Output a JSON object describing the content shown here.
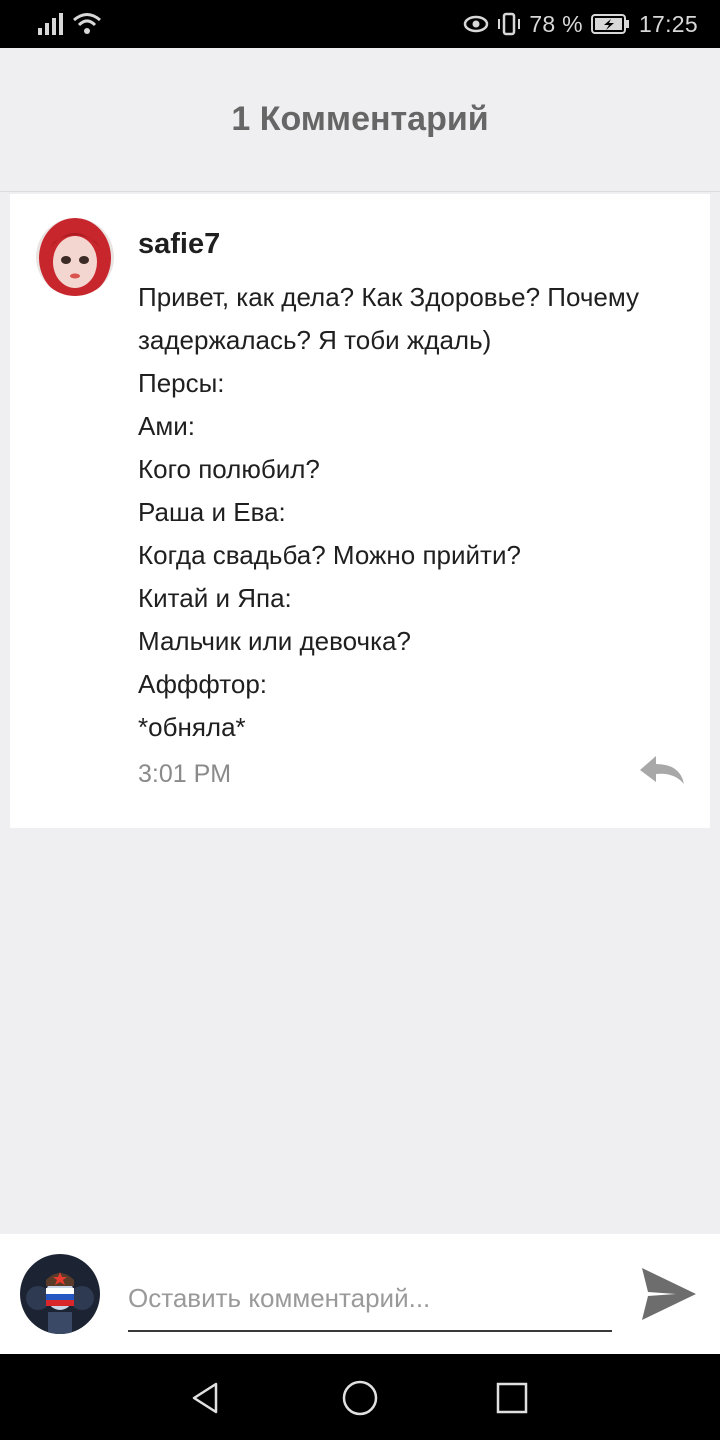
{
  "status_bar": {
    "battery_percent": "78 %",
    "time": "17:25",
    "icons": [
      "signal-icon",
      "wifi-icon",
      "eye-comfort-icon",
      "vibrate-icon",
      "battery-icon"
    ]
  },
  "header": {
    "title": "1 Комментарий"
  },
  "comment": {
    "username": "safie7",
    "lines": [
      "Привет, как дела? Как Здоровье? Почему",
      "задержалась? Я тоби ждаль)",
      "Персы:",
      "Ами:",
      "Кого полюбил?",
      "Раша и Ева:",
      "Когда свадьба? Можно прийти?",
      "Китай и Япа:",
      "Мальчик или девочка?",
      "Афффтор:",
      "*обняла*"
    ],
    "timestamp": "3:01 PM",
    "reply_icon": "reply-icon"
  },
  "input_bar": {
    "placeholder": "Оставить комментарий...",
    "value": "",
    "send_icon": "send-icon"
  },
  "nav_bar": {
    "icons": [
      "back-icon",
      "home-icon",
      "recents-icon"
    ]
  },
  "colors": {
    "background": "#efeef0",
    "card": "#ffffff",
    "header_text": "#666666",
    "timestamp": "#8a8a8a"
  }
}
